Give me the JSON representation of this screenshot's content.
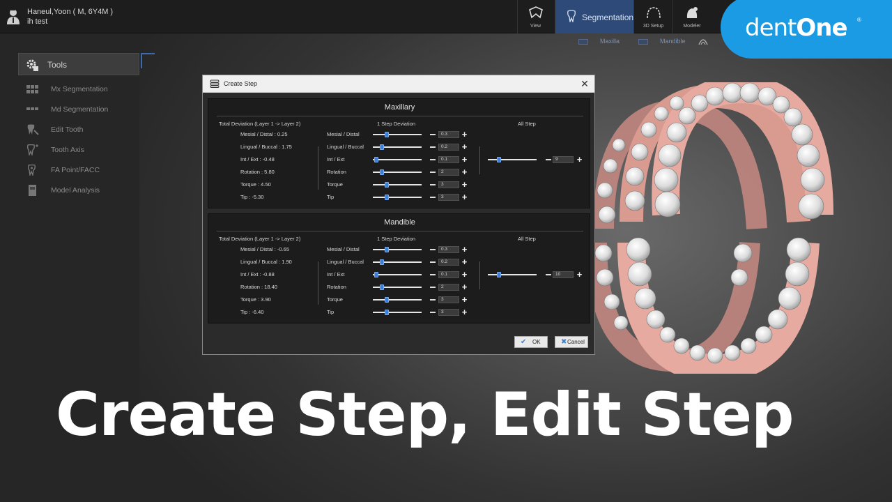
{
  "patient": {
    "name": "Haneul,Yoon ( M, 6Y4M )",
    "note": "ih test"
  },
  "toolbar": {
    "view": "View",
    "segmentation": "Segmentation",
    "setup3d": "3D Setup",
    "modeler": "Modeler"
  },
  "logo": {
    "text_a": "dent",
    "text_b": "One",
    "reg": "®",
    "color": "#1a9be3"
  },
  "jaw_tabs": {
    "maxilla": "Maxilla",
    "mandible": "Mandible"
  },
  "tools": {
    "header": "Tools",
    "items": [
      {
        "label": "Mx Segmentation",
        "icon": "upper-teeth-icon"
      },
      {
        "label": "Md Segmentation",
        "icon": "lower-teeth-icon"
      },
      {
        "label": "Edit Tooth",
        "icon": "edit-tooth-icon"
      },
      {
        "label": "Tooth Axis",
        "icon": "tooth-axis-icon"
      },
      {
        "label": "FA Point/FACC",
        "icon": "fa-point-icon"
      },
      {
        "label": "Model Analysis",
        "icon": "model-analysis-icon"
      }
    ]
  },
  "dialog": {
    "title": "Create Step",
    "ok": "OK",
    "cancel": "Cancel",
    "sections": [
      {
        "title": "Maxillary",
        "total_header": "Total Deviation (Layer 1 -> Layer 2)",
        "step_header": "1 Step Deviation",
        "all_header": "All Step",
        "totals": [
          "Mesial / Distal : 0.25",
          "Lingual / Buccal : 1.75",
          "Int / Ext : -0.48",
          "Rotation : 5.80",
          "Torque : 4.50",
          "Tip : -5.30"
        ],
        "params": [
          "Mesial / Distal",
          "Lingual / Buccal",
          "Int / Ext",
          "Rotation",
          "Torque",
          "Tip"
        ],
        "values": [
          "0.3",
          "0.2",
          "0.1",
          "2",
          "3",
          "3"
        ],
        "all_value": "9"
      },
      {
        "title": "Mandible",
        "total_header": "Total Deviation (Layer 1 -> Layer 2)",
        "step_header": "1 Step Deviation",
        "all_header": "All Step",
        "totals": [
          "Mesial / Distal : -0.65",
          "Lingual / Buccal : 1.90",
          "Int / Ext : -0.88",
          "Rotation : 18.40",
          "Torque : 3.90",
          "Tip : -6.40"
        ],
        "params": [
          "Mesial / Distal",
          "Lingual / Buccal",
          "Int / Ext",
          "Rotation",
          "Torque",
          "Tip"
        ],
        "values": [
          "0.3",
          "0.2",
          "0.1",
          "2",
          "3",
          "3"
        ],
        "all_value": "10"
      }
    ]
  },
  "caption": "Create Step, Edit Step"
}
